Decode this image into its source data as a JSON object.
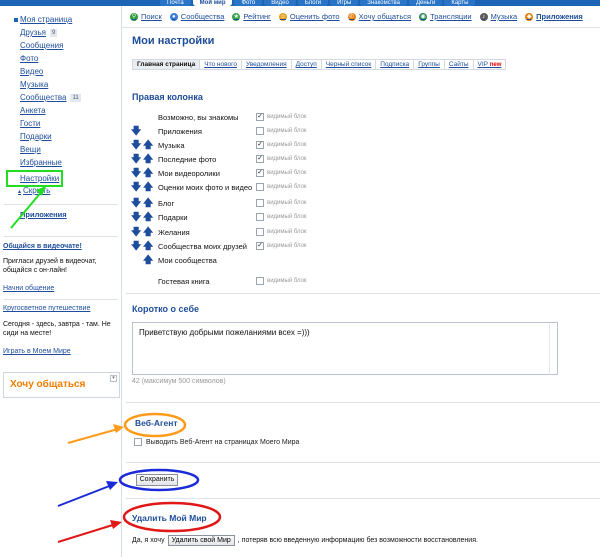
{
  "topnav": {
    "tabs": [
      "Почта",
      "Мой мир",
      "Фото",
      "Видео",
      "Блоги",
      "Игры",
      "Знакомства",
      "Деньги",
      "Карты"
    ],
    "active_tab": "Мой мир"
  },
  "sidebar": {
    "items": [
      {
        "label": "Моя страница"
      },
      {
        "label": "Друзья",
        "badge": "9"
      },
      {
        "label": "Сообщения"
      },
      {
        "label": "Фото"
      },
      {
        "label": "Видео"
      },
      {
        "label": "Музыка"
      },
      {
        "label": "Сообщества",
        "badge": "11"
      },
      {
        "label": "Анкета"
      },
      {
        "label": "Гости"
      },
      {
        "label": "Подарки"
      },
      {
        "label": "Вещи"
      },
      {
        "label": "Избранные"
      },
      {
        "label": "Настройки"
      },
      {
        "label": "Скрыть"
      },
      {
        "label": "Приложения"
      }
    ],
    "promo1": {
      "title": "Общайся в видеочате!",
      "text": "Пригласи друзей в видеочат, общайся с он-лайн!",
      "link": "Начни общение"
    },
    "promo2": {
      "title": "Кругосветное путешествие",
      "text": "Сегодня - здесь, завтра - там. Не сиди на месте!",
      "link": "Играть в Моем Мире"
    },
    "widget": {
      "title": "Хочу общаться"
    }
  },
  "navbar": {
    "items": [
      {
        "label": "Поиск",
        "icon": "search-icon",
        "color": "#2f9a3a"
      },
      {
        "label": "Сообщества",
        "icon": "communities-icon",
        "color": "#3b7dd8"
      },
      {
        "label": "Рейтинг",
        "icon": "rating-icon",
        "color": "#3aa34a"
      },
      {
        "label": "Оценить фото",
        "icon": "rate-photo-icon",
        "color": "#e8a11e"
      },
      {
        "label": "Хочу общаться",
        "icon": "chat-icon",
        "color": "#ea7f10"
      },
      {
        "label": "Трансляции",
        "icon": "broadcast-icon",
        "color": "#2e8b57"
      },
      {
        "label": "Музыка",
        "icon": "music-icon",
        "color": "#5a5a5a"
      },
      {
        "label": "Приложения",
        "icon": "apps-icon",
        "color": "#f07c00"
      }
    ]
  },
  "page": {
    "title": "Мои настройки",
    "tabs": [
      "Главная страница",
      "Что нового",
      "Уведомления",
      "Доступ",
      "Черный список",
      "Подписка",
      "Группы",
      "Сайты",
      "VIP"
    ],
    "vip_new": "new",
    "right_column": {
      "title": "Правая колонка",
      "checkbox_label": "видимый блок",
      "rows": [
        {
          "label": "Возможно, вы знакомы",
          "down": false,
          "up": false,
          "checked": true
        },
        {
          "label": "Приложения",
          "down": true,
          "up": false,
          "checked": false
        },
        {
          "label": "Музыка",
          "down": true,
          "up": true,
          "checked": true
        },
        {
          "label": "Последние фото",
          "down": true,
          "up": true,
          "checked": true
        },
        {
          "label": "Мои видеоролики",
          "down": true,
          "up": true,
          "checked": true
        },
        {
          "label": "Оценки моих фото и видео",
          "down": true,
          "up": true,
          "checked": false
        },
        {
          "label": "Блог",
          "down": true,
          "up": true,
          "checked": false
        },
        {
          "label": "Подарки",
          "down": true,
          "up": true,
          "checked": false
        },
        {
          "label": "Желания",
          "down": true,
          "up": true,
          "checked": false
        },
        {
          "label": "Сообщества моих друзей",
          "down": true,
          "up": true,
          "checked": true
        },
        {
          "label": "Мои сообщества",
          "down": false,
          "up": true,
          "checked": false
        },
        {
          "label": "Гостевая книга",
          "down": false,
          "up": false,
          "checked": false
        }
      ]
    },
    "about": {
      "title": "Коротко о себе",
      "value": "Приветствую добрыми пожеланиями всех =)))",
      "hint": "42 (максимум 500 символов)"
    },
    "agent": {
      "title": "Веб-Агент",
      "checkbox_label": "Выводить Веб-Агент на страницах Моего Мира"
    },
    "save_label": "Сохранить",
    "delete": {
      "title": "Удалить Мой Мир",
      "prefix": "Да, я хочу",
      "button": "Удалить свой Мир",
      "suffix": ", потеряв всю введенную информацию без возможности восстановления."
    }
  },
  "colors": {
    "accent": "#1e4d9b",
    "highlight_green": "#22dd22",
    "highlight_orange": "#ff9a1a",
    "highlight_blue": "#1a2ad8",
    "highlight_red": "#e01818"
  }
}
